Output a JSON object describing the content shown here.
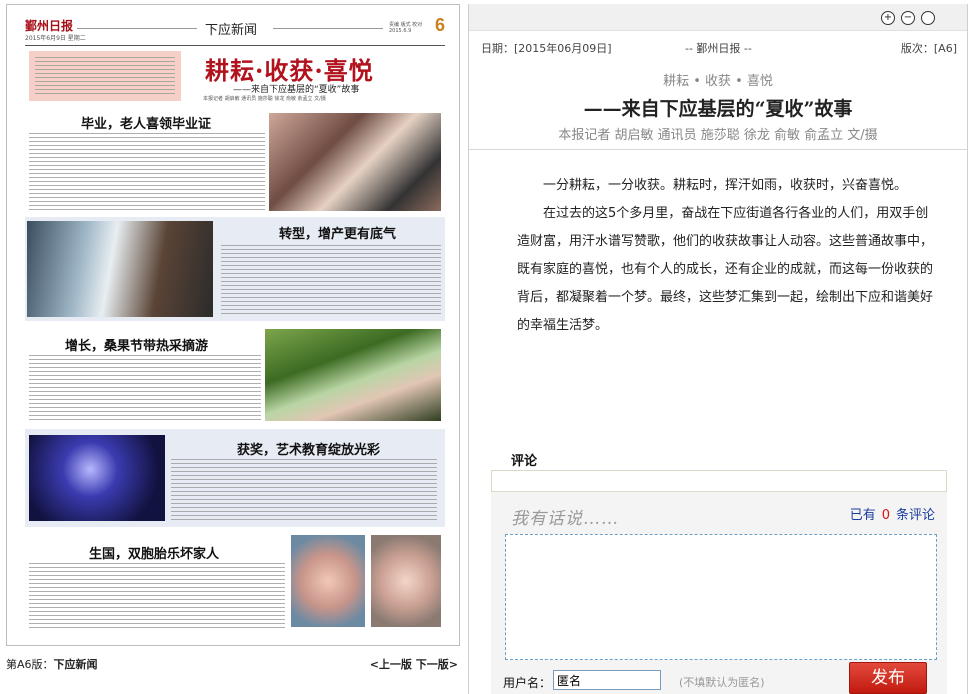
{
  "newspaper": {
    "logo": "鄞州日报",
    "date_line": "2015年6月9日 星期二",
    "section": "下应新闻",
    "meta": "责编 版式 校对 2015.6.9",
    "page_number": "6",
    "lead_title": "耕耘·收获·喜悦",
    "lead_subtitle": "——来自下应基层的“夏收”故事",
    "lead_byline": "本报记者 胡启敏 通讯员 施莎聪 徐龙 俞敏 俞孟立 文/摄",
    "headlines": [
      "毕业，老人喜领毕业证",
      "转型，增产更有底气",
      "增长，桑果节带热采摘游",
      "获奖，艺术教育绽放光彩",
      "生国，双胞胎乐坏家人"
    ]
  },
  "pager": {
    "page_label": "第A6版：",
    "page_name": "下应新闻",
    "prev": "<上一版",
    "next": "下一版>"
  },
  "toolbar": {
    "zoom_in": "+",
    "zoom_out": "−",
    "reset": ""
  },
  "article_meta": {
    "date": "日期：[2015年06月09日]",
    "paper": "-- 鄞州日报 --",
    "edition": "版次：[A6]"
  },
  "article": {
    "kicker": "耕耘 • 收获 • 喜悦",
    "title": "——来自下应基层的“夏收”故事",
    "byline": "本报记者 胡启敏 通讯员 施莎聪 徐龙 俞敏 俞孟立 文/摄",
    "paragraphs": [
      "一分耕耘，一分收获。耕耘时，挥汗如雨，收获时，兴奋喜悦。",
      "在过去的这5个多月里，奋战在下应街道各行各业的人们，用双手创造财富，用汗水谱写赞歌，他们的收获故事让人动容。这些普通故事中，既有家庭的喜悦，也有个人的成长，还有企业的成就，而这每一份收获的背后，都凝聚着一个梦。最终，这些梦汇集到一起，绘制出下应和谐美好的幸福生活梦。"
    ]
  },
  "comments": {
    "label": "评论",
    "hint": "我有话说……",
    "count_prefix": "已有",
    "count": "0",
    "count_suffix": "条评论",
    "textarea_value": "",
    "username_label": "用户名：",
    "username_value": "匿名",
    "username_hint": "(不填默认为匿名)",
    "submit_label": "发布"
  }
}
